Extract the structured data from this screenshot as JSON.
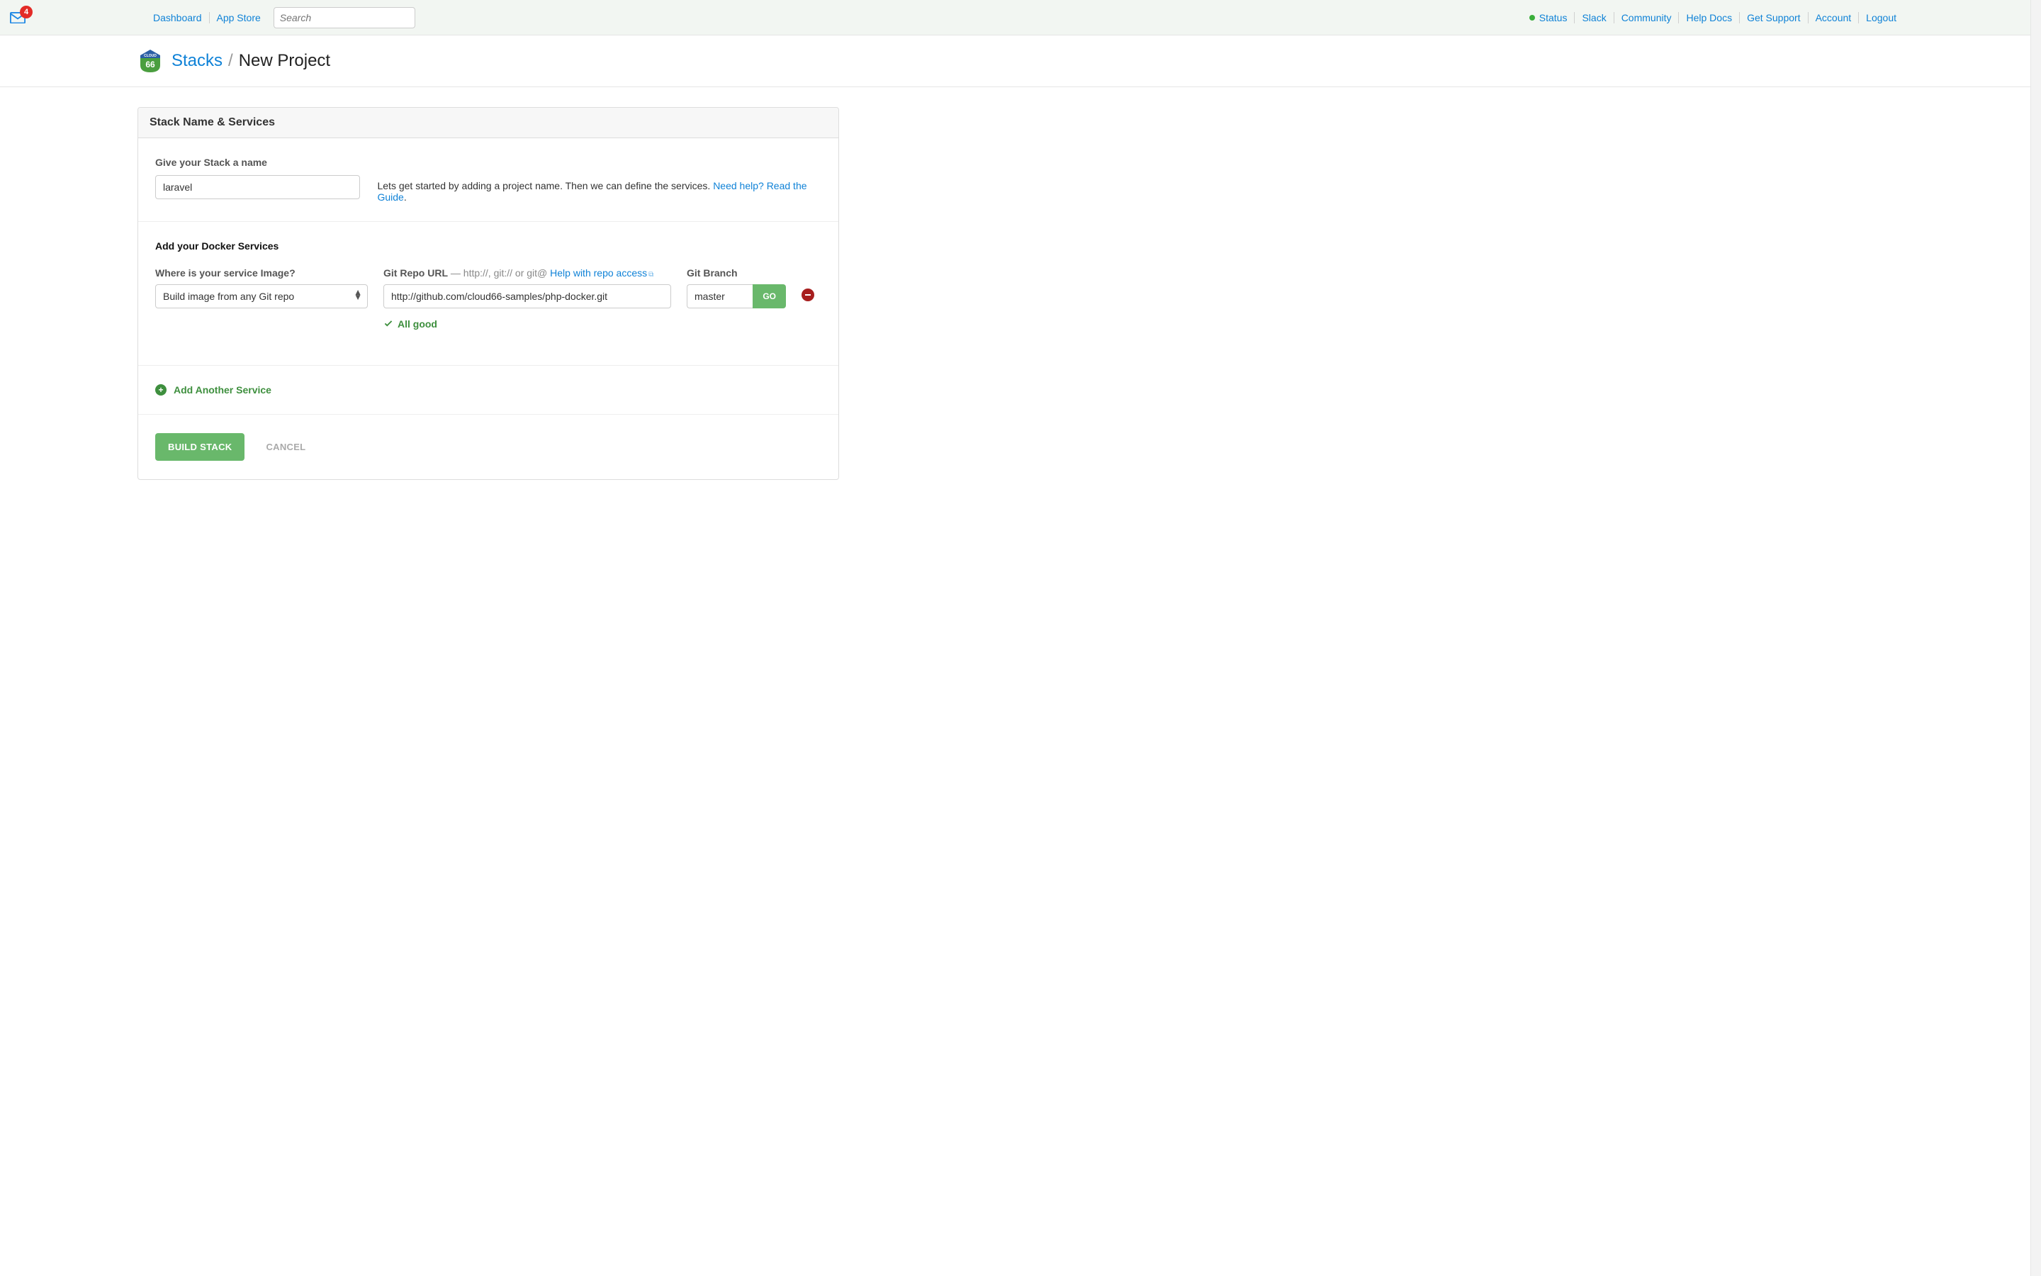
{
  "notifications": {
    "count": "4"
  },
  "nav": {
    "dashboard": "Dashboard",
    "appstore": "App Store",
    "search_placeholder": "Search",
    "status": "Status",
    "slack": "Slack",
    "community": "Community",
    "helpdocs": "Help Docs",
    "getsupport": "Get Support",
    "account": "Account",
    "logout": "Logout"
  },
  "breadcrumb": {
    "stacks": "Stacks",
    "sep": "/",
    "current": "New Project"
  },
  "panel": {
    "heading": "Stack Name & Services",
    "name_section": {
      "label": "Give your Stack a name",
      "value": "laravel",
      "helper_prefix": "Lets get started by adding a project name. Then we can define the services. ",
      "helper_link": "Need help? Read the Guide",
      "helper_suffix": "."
    },
    "services_section": {
      "title": "Add your Docker Services",
      "image_label": "Where is your service Image?",
      "image_select_value": "Build image from any Git repo",
      "repo_label": "Git Repo URL",
      "repo_hint": " — http://, git:// or git@ ",
      "repo_help": "Help with repo access",
      "repo_value": "http://github.com/cloud66-samples/php-docker.git",
      "branch_label": "Git Branch",
      "branch_value": "master",
      "go_label": "GO",
      "allgood": "All good"
    },
    "add_service": "Add Another Service",
    "build_label": "BUILD STACK",
    "cancel_label": "CANCEL"
  }
}
